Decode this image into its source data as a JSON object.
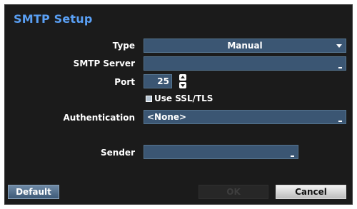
{
  "title": "SMTP Setup",
  "type": {
    "label": "Type",
    "value": "Manual"
  },
  "smtp_server": {
    "label": "SMTP Server",
    "value": ""
  },
  "port": {
    "label": "Port",
    "value": "25"
  },
  "ssl": {
    "label": "Use SSL/TLS",
    "checked": false
  },
  "authentication": {
    "label": "Authentication",
    "value": "<None>"
  },
  "sender": {
    "label": "Sender",
    "value": ""
  },
  "buttons": {
    "default_label": "Default",
    "ok_label": "OK",
    "cancel_label": "Cancel"
  },
  "colors": {
    "title": "#5aa0f5",
    "field_bg": "#3b5673",
    "dialog_bg": "#1b1b1b"
  }
}
